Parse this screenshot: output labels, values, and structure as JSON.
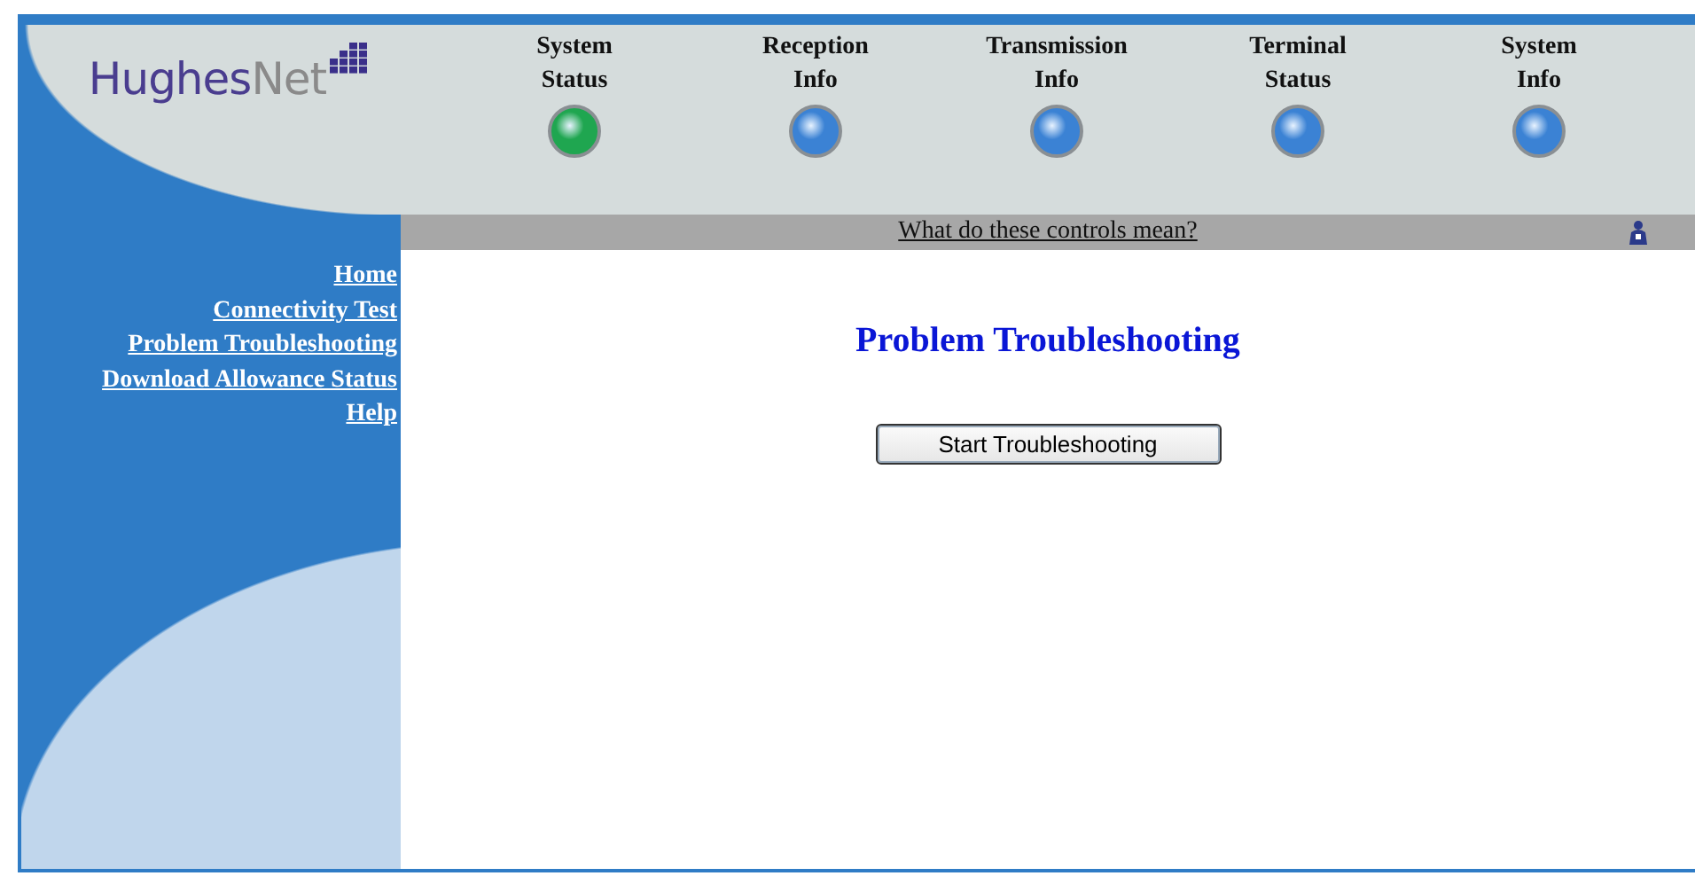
{
  "logo": {
    "first": "Hughes",
    "second": "Net"
  },
  "status_indicators": [
    {
      "label": "System Status",
      "color": "#1fa650"
    },
    {
      "label": "Reception Info",
      "color": "#3b82d4"
    },
    {
      "label": "Transmission Info",
      "color": "#3b82d4"
    },
    {
      "label": "Terminal Status",
      "color": "#3b82d4"
    },
    {
      "label": "System Info",
      "color": "#3b82d4"
    }
  ],
  "help_bar": {
    "link": "What do these controls mean?"
  },
  "sidebar": {
    "items": [
      "Home",
      "Connectivity Test",
      "Problem Troubleshooting",
      "Download Allowance Status",
      "Help"
    ]
  },
  "content": {
    "title": "Problem Troubleshooting",
    "button": "Start Troubleshooting"
  }
}
